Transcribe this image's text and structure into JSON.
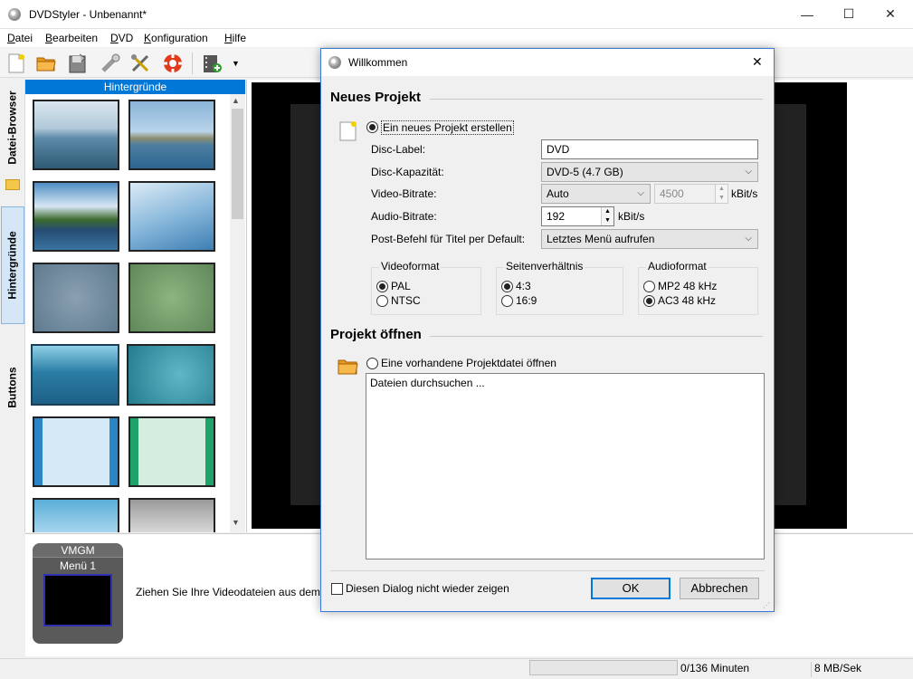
{
  "window": {
    "title": "DVDStyler - Unbenannt*",
    "minimize": "—",
    "maximize": "☐",
    "close": "✕"
  },
  "menu": {
    "items": [
      {
        "accel": "D",
        "rest": "atei"
      },
      {
        "accel": "B",
        "rest": "earbeiten"
      },
      {
        "accel": "D",
        "rest": "VD"
      },
      {
        "accel": "K",
        "rest": "onfiguration"
      },
      {
        "accel": "H",
        "rest": "ilfe"
      }
    ]
  },
  "sidetabs": {
    "file_browser": "Datei-Browser",
    "backgrounds": "Hintergründe",
    "buttons": "Buttons"
  },
  "palette": {
    "header": "Hintergründe",
    "scroll_up": "▲",
    "scroll_down": "▼"
  },
  "bottom": {
    "vmgm": "VMGM",
    "menu1": "Menü 1",
    "hint": "Ziehen Sie Ihre Videodateien aus dem"
  },
  "status": {
    "minutes": "0/136 Minuten",
    "rate": "8 MB/Sek"
  },
  "dialog": {
    "title": "Willkommen",
    "close": "✕",
    "new_section": "Neues Projekt",
    "new_radio": "Ein neues Projekt erstellen",
    "disc_label_lbl": "Disc-Label:",
    "disc_label_val": "DVD",
    "disc_cap_lbl": "Disc-Kapazität:",
    "disc_cap_val": "DVD-5 (4.7 GB)",
    "video_bitrate_lbl": "Video-Bitrate:",
    "video_bitrate_mode": "Auto",
    "video_bitrate_val": "4500",
    "video_unit": "kBit/s",
    "audio_bitrate_lbl": "Audio-Bitrate:",
    "audio_bitrate_val": "192",
    "audio_unit": "kBit/s",
    "post_lbl": "Post-Befehl für Titel per Default:",
    "post_val": "Letztes Menü aufrufen",
    "video_format": {
      "title": "Videoformat",
      "opt1": "PAL",
      "opt2": "NTSC"
    },
    "aspect": {
      "title": "Seitenverhältnis",
      "opt1": "4:3",
      "opt2": "16:9"
    },
    "audio_format": {
      "title": "Audioformat",
      "opt1": "MP2 48 kHz",
      "opt2": "AC3 48 kHz"
    },
    "open_section": "Projekt öffnen",
    "open_radio": "Eine vorhandene Projektdatei öffnen",
    "list_item": "Dateien durchsuchen ...",
    "dont_show": "Diesen Dialog nicht wieder zeigen",
    "ok": "OK",
    "cancel": "Abbrechen"
  },
  "colors": {
    "accent": "#0078d7",
    "dialog_border": "#3a7bd5",
    "preview": "#000000"
  }
}
